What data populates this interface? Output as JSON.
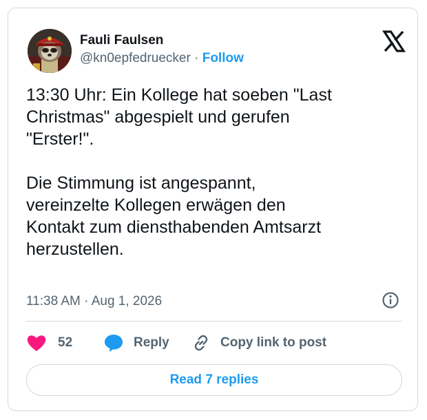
{
  "author": {
    "name": "Fauli Faulsen",
    "handle": "@kn0epfedruecker",
    "separator": "·",
    "follow_label": "Follow",
    "avatar_icon": "sloth-avatar-image"
  },
  "platform_icon": "x-logo-icon",
  "tweet": {
    "text": "13:30 Uhr: Ein Kollege hat soeben \"Last\nChristmas\" abgespielt und gerufen\n\"Erster!\".\n\nDie Stimmung ist angespannt,\nvereinzelte Kollegen erwägen den\nKontakt zum diensthabenden Amtsarzt\nherzustellen.",
    "timestamp": "11:38 AM · Aug 1, 2026"
  },
  "actions": {
    "like_count": "52",
    "reply_label": "Reply",
    "copy_label": "Copy link to post"
  },
  "read_replies_label": "Read 7 replies",
  "colors": {
    "accent": "#1d9bf0",
    "like": "#f91880",
    "text": "#0f1419",
    "muted": "#536471",
    "border": "#cfd9de"
  }
}
